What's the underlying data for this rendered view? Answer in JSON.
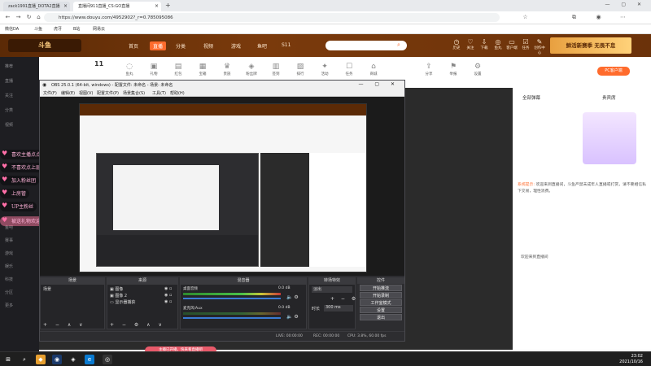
{
  "browser": {
    "tabs": [
      {
        "label": "zack1991直播_DOTA2直播",
        "active": false
      },
      {
        "label": "直播间911直播_CS:GO直播",
        "active": true
      }
    ],
    "new_tab": "+",
    "url": "https://www.douyu.com/4952902?_r=0.785095086",
    "bookmarks": [
      "微信DA",
      "斗鱼",
      "虎牙",
      "B站",
      "网易云"
    ]
  },
  "site": {
    "logo": "斗鱼",
    "nav": [
      "首页",
      "直播",
      "分类",
      "视频",
      "游戏",
      "鱼吧",
      "S11"
    ],
    "active_nav": "直播",
    "top_icons": [
      "历史",
      "关注",
      "下载",
      "鱼丸",
      "客户端",
      "任务",
      "创作中心",
      "个人中心"
    ],
    "banner": "鲜活新赛季 无畏不怠"
  },
  "sidebar": {
    "items": [
      "推荐",
      "直播",
      "关注",
      "分类",
      "视频",
      "鱼吧",
      "赛事",
      "游戏",
      "娱乐",
      "科技",
      "分区",
      "更多"
    ]
  },
  "room": {
    "score": "11",
    "icons": [
      "鱼丸",
      "礼物",
      "红包",
      "宝箱",
      "贵族",
      "粉丝牌",
      "签到",
      "排行",
      "活动",
      "任务",
      "商城",
      "分享",
      "举报",
      "设置"
    ],
    "pc_badge": "PC客户端",
    "chat_tabs": [
      "全部弹幕",
      "贵宾席"
    ],
    "notice_label": "系统提示:",
    "notice_text": "欢迎来到直播间，斗鱼严禁未成年人直播或打赏，请不要相信私下交易，理性消费。",
    "welcome": "欢迎来到直播间"
  },
  "obs": {
    "title": "OBS 25.0.1 (64-bit, windows) - 配置文件: 未命名 - 场景: 未命名",
    "menu": [
      "文件(F)",
      "编辑(E)",
      "视图(V)",
      "配置文件(P)",
      "场景集合(S)",
      "工具(T)",
      "帮助(H)"
    ],
    "docks": {
      "scenes": "场景",
      "sources": "来源",
      "mixer": "混音器",
      "transitions": "转场特效",
      "controls": "控件"
    },
    "scene_item": "场景",
    "source_items": [
      "图像",
      "图像 2",
      "显示器捕获"
    ],
    "mixer": [
      {
        "label": "桌面音频",
        "db": "0.0 dB"
      },
      {
        "label": "麦克风/Aux",
        "db": "0.0 dB"
      }
    ],
    "transition_type": "淡出",
    "duration_label": "时长",
    "duration_value": "300 ms",
    "controls": [
      "开始推流",
      "开始录制",
      "工作室模式",
      "设置",
      "退出"
    ],
    "status": {
      "live": "LIVE: 00:00:00",
      "rec": "REC: 00:00:00",
      "cpu": "CPU: 3.8%, 60.00 fps"
    }
  },
  "chat_overlay": [
    "喜欢主播点点关注",
    "不喜欢点上层右滑",
    "加入粉丝团",
    "上房管",
    "UP主粉丝",
    "被送礼物欢迎"
  ],
  "toast": "主播已开播，快来看直播吧",
  "taskbar": {
    "time": "23:02",
    "date": "2021/10/16"
  },
  "colors": {
    "accent": "#ff6b2c",
    "header_bg": "#5b2a06",
    "obs_bg": "#2d2d30",
    "chat_pink": "#ffb3d9"
  }
}
